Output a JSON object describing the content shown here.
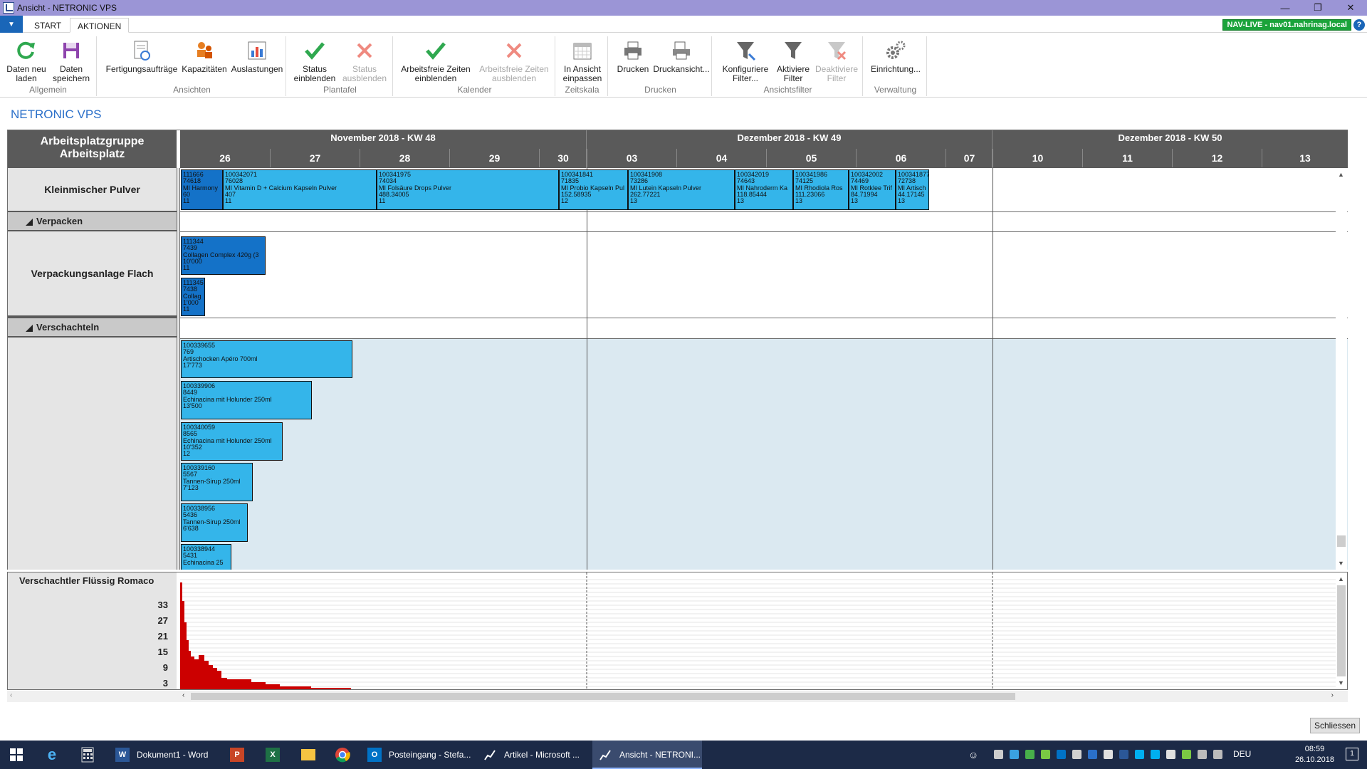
{
  "window": {
    "title": "Ansicht - NETRONIC VPS"
  },
  "tabs": [
    "START",
    "AKTIONEN"
  ],
  "active_tab": "AKTIONEN",
  "environment_badge": "NAV-LIVE - nav01.nahrinag.local",
  "ribbon": {
    "groups": [
      {
        "label": "Allgemein",
        "buttons": [
          {
            "label": "Daten neu laden",
            "icon": "refresh-icon",
            "enabled": true
          },
          {
            "label": "Daten speichern",
            "icon": "save-icon",
            "enabled": true
          }
        ]
      },
      {
        "label": "Ansichten",
        "buttons": [
          {
            "label": "Fertigungsaufträge",
            "icon": "production-orders-icon",
            "enabled": true
          },
          {
            "label": "Kapazitäten",
            "icon": "capacities-icon",
            "enabled": true
          },
          {
            "label": "Auslastungen",
            "icon": "utilization-icon",
            "enabled": true
          }
        ]
      },
      {
        "label": "Plantafel",
        "buttons": [
          {
            "label": "Status einblenden",
            "icon": "check-icon",
            "enabled": true
          },
          {
            "label": "Status ausblenden",
            "icon": "cross-icon",
            "enabled": false
          }
        ]
      },
      {
        "label": "Kalender",
        "buttons": [
          {
            "label": "Arbeitsfreie Zeiten einblenden",
            "icon": "check-icon",
            "enabled": true
          },
          {
            "label": "Arbeitsfreie Zeiten ausblenden",
            "icon": "cross-icon",
            "enabled": false
          }
        ]
      },
      {
        "label": "Zeitskala",
        "buttons": [
          {
            "label": "In Ansicht einpassen",
            "icon": "calendar-icon",
            "enabled": true
          }
        ]
      },
      {
        "label": "Drucken",
        "buttons": [
          {
            "label": "Drucken",
            "icon": "printer-icon",
            "enabled": true
          },
          {
            "label": "Druckansicht...",
            "icon": "print-preview-icon",
            "enabled": true
          }
        ]
      },
      {
        "label": "Ansichtsfilter",
        "buttons": [
          {
            "label": "Konfiguriere Filter...",
            "icon": "filter-config-icon",
            "enabled": true
          },
          {
            "label": "Aktiviere Filter",
            "icon": "filter-icon",
            "enabled": true
          },
          {
            "label": "Deaktiviere Filter",
            "icon": "filter-off-icon",
            "enabled": false
          }
        ]
      },
      {
        "label": "Verwaltung",
        "buttons": [
          {
            "label": "Einrichtung...",
            "icon": "gears-icon",
            "enabled": true
          }
        ]
      }
    ]
  },
  "app_heading": "NETRONIC VPS",
  "gantt": {
    "header_left": [
      "Arbeitsplatzgruppe",
      "Arbeitsplatz"
    ],
    "weeks": [
      "November 2018 - KW 48",
      "Dezember 2018 - KW 49",
      "Dezember 2018 - KW 50"
    ],
    "days": [
      "26",
      "27",
      "28",
      "29",
      "30",
      "03",
      "04",
      "05",
      "06",
      "07",
      "10",
      "11",
      "12",
      "13"
    ],
    "rows": {
      "kleinmischer": "Kleinmischer Pulver",
      "group_verpacken": "Verpacken",
      "verpackungsanlage": "Verpackungsanlage Flach",
      "group_verschachteln": "Verschachteln"
    },
    "kleinmischer_bars": [
      [
        "111666",
        "74618",
        "MI Harmony",
        "60",
        "11"
      ],
      [
        "100342071",
        "76028",
        "MI Vitamin D + Calcium Kapseln Pulver",
        "407",
        "11"
      ],
      [
        "100341975",
        "74034",
        "MI Folsäure Drops Pulver",
        "488.34005",
        "11"
      ],
      [
        "100341841",
        "71835",
        "MI Probio Kapseln Pul",
        "152.58935",
        "12"
      ],
      [
        "100341908",
        "73286",
        "MI Lutein Kapseln Pulver",
        "262.77221",
        "13"
      ],
      [
        "100342019",
        "74643",
        "MI Nahroderm Ka",
        "118.85444",
        "13"
      ],
      [
        "100341986",
        "74125",
        "MI Rhodiola Ros",
        "111.23066",
        "13"
      ],
      [
        "100342002",
        "74469",
        "MI Rotklee Trif",
        "84.71994",
        "13"
      ],
      [
        "100341877",
        "72738",
        "MI Artisch",
        "44.17145",
        "13"
      ]
    ],
    "verpackung_bars": [
      [
        "111344",
        "7439",
        "Collagen Complex 420g (3",
        "10'000",
        "11"
      ],
      [
        "111345",
        "7438",
        "Collag",
        "1'000",
        "11"
      ]
    ],
    "verschachteln_bars": [
      [
        "100339655",
        "769",
        "Artischocken Apéro 700ml",
        "17'773"
      ],
      [
        "100339906",
        "8449",
        "Echinacina mit Holunder 250ml",
        "13'500"
      ],
      [
        "100340059",
        "8565",
        "Echinacina mit Holunder 250ml",
        "10'352",
        "12"
      ],
      [
        "100339160",
        "5567",
        "Tannen-Sirup 250ml",
        "7'123"
      ],
      [
        "100338956",
        "5436",
        "Tannen-Sirup 250ml",
        "6'638"
      ],
      [
        "100338944",
        "5431",
        "Echinacina 25"
      ]
    ]
  },
  "histogram": {
    "title": "Verschachtler Flüssig Romaco",
    "y_ticks": [
      "33",
      "27",
      "21",
      "15",
      "9",
      "3"
    ],
    "color": "#cc0000"
  },
  "close_button": "Schliessen",
  "taskbar": {
    "apps": [
      {
        "label": "Dokument1 - Word",
        "icon": "word-icon"
      },
      {
        "label": "Posteingang - Stefa...",
        "icon": "outlook-icon"
      },
      {
        "label": "Artikel - Microsoft ...",
        "icon": "nav-icon"
      },
      {
        "label": "Ansicht - NETRONI...",
        "icon": "netronic-icon"
      }
    ],
    "language": "DEU",
    "time": "08:59",
    "date": "26.10.2018",
    "notification_count": "1"
  }
}
